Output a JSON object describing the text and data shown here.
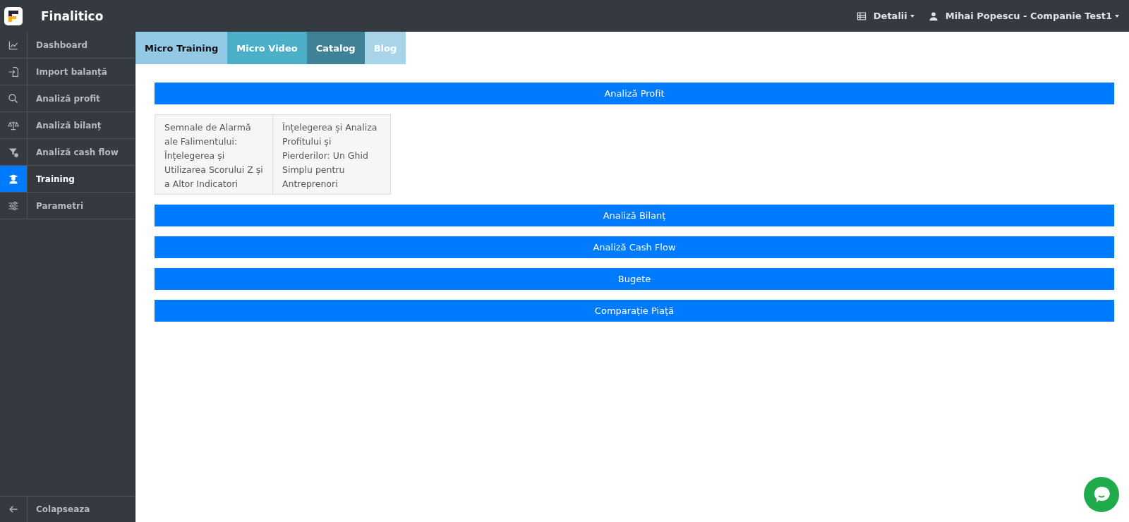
{
  "header": {
    "brand": "Finalitico",
    "menus": [
      {
        "kind": "details",
        "label": "Detalii"
      },
      {
        "kind": "user",
        "label": "Mihai Popescu - Companie Test1"
      }
    ]
  },
  "sidebar": {
    "items": [
      {
        "label": "Dashboard",
        "selected": false
      },
      {
        "label": "Import balanță",
        "selected": false
      },
      {
        "label": "Analiză profit",
        "selected": false
      },
      {
        "label": "Analiză bilanț",
        "selected": false
      },
      {
        "label": "Analiză cash flow",
        "selected": false
      },
      {
        "label": "Training",
        "selected": true
      },
      {
        "label": "Parametri",
        "selected": false
      }
    ],
    "collapse": "Colapseaza"
  },
  "tabs": [
    {
      "label": "Micro Training",
      "color": "#93c9e4"
    },
    {
      "label": "Micro Video",
      "color": "#4bafc8"
    },
    {
      "label": "Catalog",
      "color": "#3f8196"
    },
    {
      "label": "Blog",
      "color": "#a8d4ea"
    }
  ],
  "sections": [
    {
      "title": "Analiză Profit",
      "cards": [
        "Semnale de Alarmă ale Falimentului: Înțelegerea și Utilizarea Scorului Z și a Altor Indicatori",
        "Înțelegerea și Analiza Profitului și Pierderilor: Un Ghid Simplu pentru Antreprenori"
      ]
    },
    {
      "title": "Analiză Bilanț"
    },
    {
      "title": "Analiză Cash Flow"
    },
    {
      "title": "Bugete"
    },
    {
      "title": "Comparație Piață"
    }
  ]
}
